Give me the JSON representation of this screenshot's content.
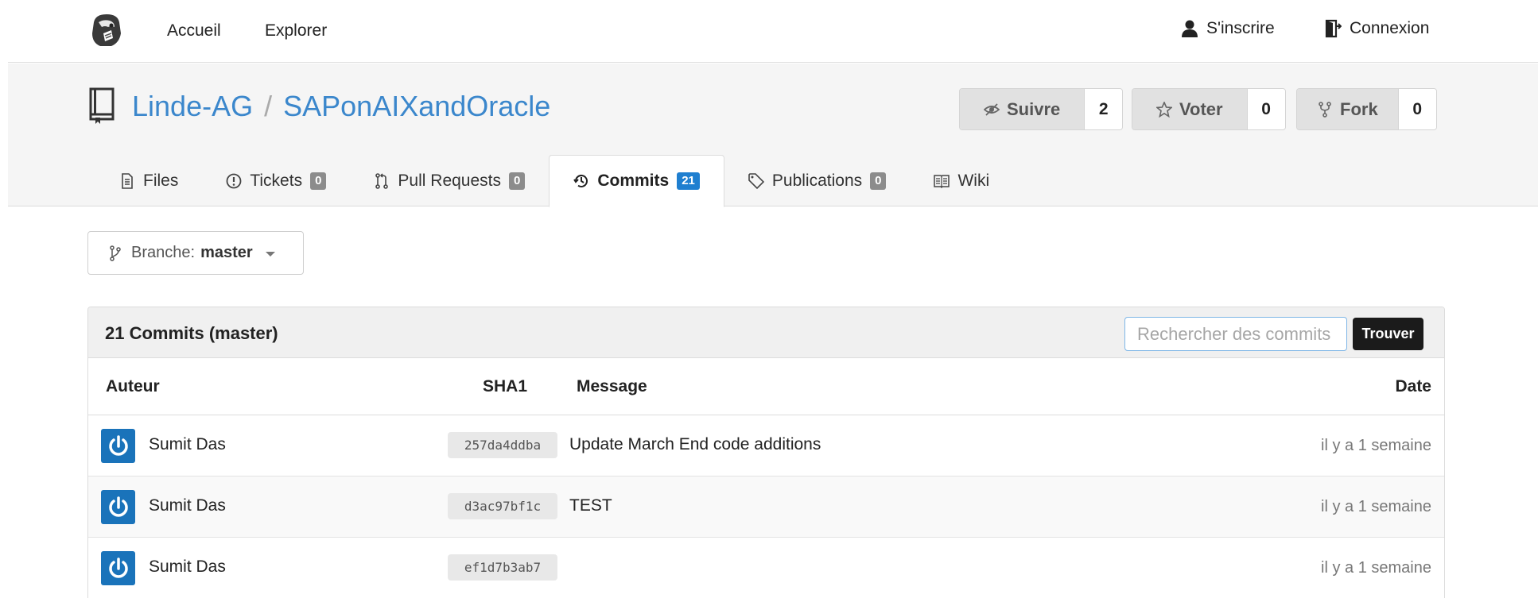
{
  "nav": {
    "home": "Accueil",
    "explore": "Explorer",
    "register": "S'inscrire",
    "login": "Connexion"
  },
  "repo": {
    "owner": "Linde-AG",
    "separator": "/",
    "name": "SAPonAIXandOracle",
    "watch_label": "Suivre",
    "watch_count": "2",
    "star_label": "Voter",
    "star_count": "0",
    "fork_label": "Fork",
    "fork_count": "0"
  },
  "tabs": [
    {
      "label": "Files",
      "badge": ""
    },
    {
      "label": "Tickets",
      "badge": "0"
    },
    {
      "label": "Pull Requests",
      "badge": "0"
    },
    {
      "label": "Commits",
      "badge": "21"
    },
    {
      "label": "Publications",
      "badge": "0"
    },
    {
      "label": "Wiki",
      "badge": ""
    }
  ],
  "branch": {
    "prefix": "Branche:",
    "name": "master"
  },
  "commits": {
    "title": "21 Commits (master)",
    "search_placeholder": "Rechercher des commits",
    "find_label": "Trouver",
    "columns": {
      "author": "Auteur",
      "sha": "SHA1",
      "message": "Message",
      "date": "Date"
    },
    "rows": [
      {
        "author": "Sumit Das",
        "sha": "257da4ddba",
        "message": "Update March End code additions",
        "date": "il y a 1 semaine"
      },
      {
        "author": "Sumit Das",
        "sha": "d3ac97bf1c",
        "message": "TEST",
        "date": "il y a 1 semaine"
      },
      {
        "author": "Sumit Das",
        "sha": "ef1d7b3ab7",
        "message": "",
        "date": "il y a 1 semaine"
      }
    ]
  },
  "colors": {
    "link": "#3b87cc",
    "avatar": "#1a73ba",
    "commits_badge": "#1f7fd0"
  }
}
